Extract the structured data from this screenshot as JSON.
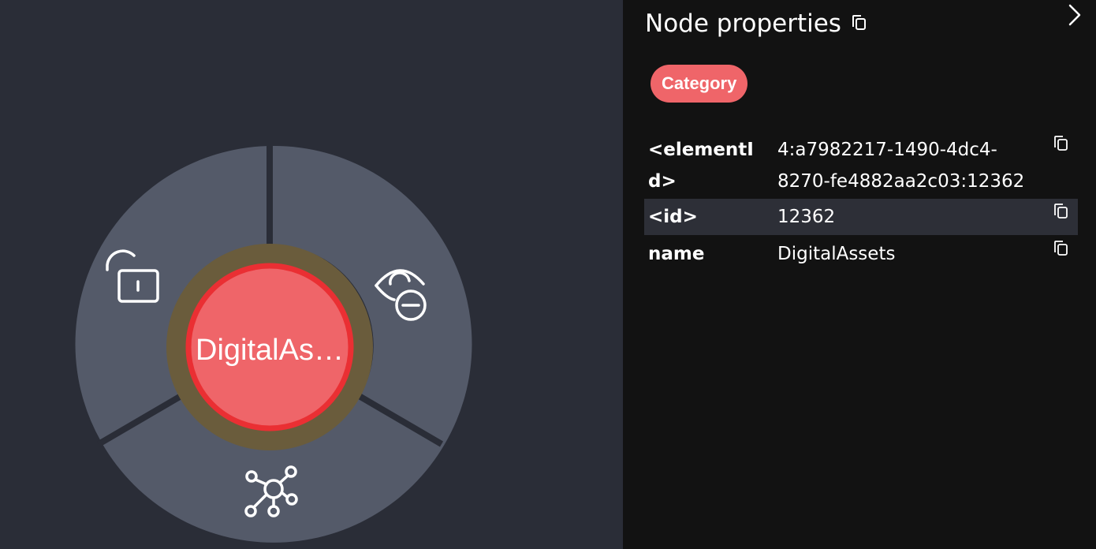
{
  "canvas": {
    "node": {
      "label": "DigitalAs…",
      "fill_color": "#ef6569",
      "ring_color": "#ea2f33",
      "halo_color": "#6a5c3c"
    },
    "radial_menu": {
      "segment_color": "#545a69",
      "items": [
        {
          "icon": "unlock-icon",
          "action": "unpin"
        },
        {
          "icon": "hide-icon",
          "action": "dismiss"
        },
        {
          "icon": "expand-icon",
          "action": "expand"
        }
      ]
    }
  },
  "panel": {
    "title": "Node properties",
    "labels": [
      "Category"
    ],
    "properties": [
      {
        "key": "<elementId>",
        "value": "4:a7982217-1490-4dc4-8270-fe4882aa2c03:12362"
      },
      {
        "key": "<id>",
        "value": "12362"
      },
      {
        "key": "name",
        "value": "DigitalAssets"
      }
    ]
  },
  "colors": {
    "canvas_bg": "#2a2d37",
    "panel_bg": "#121212",
    "badge": "#ef6569",
    "row_highlight": "#2d2f37"
  }
}
